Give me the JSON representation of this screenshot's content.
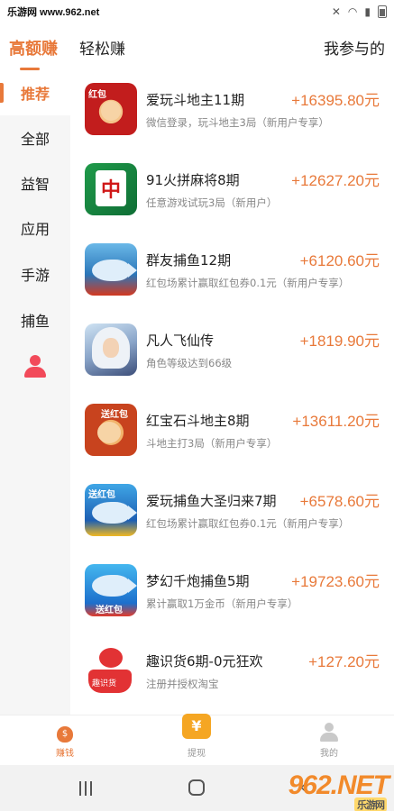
{
  "status_bar": {
    "watermark": "乐游网 www.962.net"
  },
  "top_tabs": {
    "high_earn": "高额赚",
    "easy_earn": "轻松赚",
    "participated": "我参与的"
  },
  "sidebar": {
    "items": [
      {
        "label": "推荐",
        "active": true
      },
      {
        "label": "全部",
        "active": false
      },
      {
        "label": "益智",
        "active": false
      },
      {
        "label": "应用",
        "active": false
      },
      {
        "label": "手游",
        "active": false
      },
      {
        "label": "捕鱼",
        "active": false
      }
    ],
    "profile_icon": "person-icon"
  },
  "tasks": [
    {
      "title": "爱玩斗地主11期",
      "reward": "+16395.80元",
      "desc": "微信登录，玩斗地主3局（新用户专享）",
      "thumb_text": "红包"
    },
    {
      "title": "91火拼麻将8期",
      "reward": "+12627.20元",
      "desc": "任意游戏试玩3局（新用户）",
      "thumb_text": "中"
    },
    {
      "title": "群友捕鱼12期",
      "reward": "+6120.60元",
      "desc": "红包场累计赢取红包券0.1元（新用户专享）",
      "thumb_text": ""
    },
    {
      "title": "凡人飞仙传",
      "reward": "+1819.90元",
      "desc": "角色等级达到66级",
      "thumb_text": ""
    },
    {
      "title": "红宝石斗地主8期",
      "reward": "+13611.20元",
      "desc": "斗地主打3局（新用户专享）",
      "thumb_text": "送红包"
    },
    {
      "title": "爱玩捕鱼大圣归来7期",
      "reward": "+6578.60元",
      "desc": "红包场累计赢取红包券0.1元（新用户专享）",
      "thumb_text": "送红包"
    },
    {
      "title": "梦幻千炮捕鱼5期",
      "reward": "+19723.60元",
      "desc": "累计赢取1万金币（新用户专享）",
      "thumb_text": "送红包"
    },
    {
      "title": "趣识货6期-0元狂欢",
      "reward": "+127.20元",
      "desc": "注册并授权淘宝",
      "thumb_text": "趣识货"
    }
  ],
  "bottom_nav": {
    "earn": "赚钱",
    "withdraw": "提现",
    "mine": "我的",
    "withdraw_symbol": "¥",
    "earn_symbol": "$"
  },
  "brand": {
    "logo": "962.NET",
    "sub": "乐游网"
  },
  "colors": {
    "accent": "#e8793a",
    "sidebar_bg": "#f6f6f6",
    "desc_gray": "#888888",
    "profile_red": "#f24a5a"
  }
}
